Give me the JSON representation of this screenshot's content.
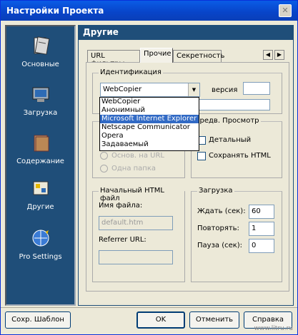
{
  "window": {
    "title": "Настройки Проекта",
    "close_label": "✕"
  },
  "sidebar": {
    "items": [
      {
        "label": "Основные",
        "icon": "notebook-icon"
      },
      {
        "label": "Загрузка",
        "icon": "monitor-download-icon"
      },
      {
        "label": "Содержание",
        "icon": "folder-icon"
      },
      {
        "label": "Другие",
        "icon": "tools-icon"
      },
      {
        "label": "Pro Settings",
        "icon": "globe-settings-icon"
      }
    ]
  },
  "content": {
    "header": "Другие",
    "tabs": [
      "URL фильтры",
      "Прочие",
      "Секретность"
    ],
    "active_tab": "Прочие"
  },
  "identification": {
    "title": "Идентификация",
    "selected": "WebCopier",
    "version_label": "версия",
    "options": [
      "WebCopier",
      "Анонимный",
      "Microsoft Internet Explorer",
      "Netscape Communicator",
      "Opera",
      "Задаваемый"
    ],
    "highlighted": "Microsoft Internet Explorer"
  },
  "save_group": {
    "radio1": "Основ. на URL",
    "radio2": "Одна папка"
  },
  "preview": {
    "title": "Предв. Просмотр",
    "detailed": "Детальный",
    "save_html": "Сохранять HTML"
  },
  "start_html": {
    "title": "Начальный HTML файл",
    "filename_label": "Имя файла:",
    "filename_value": "default.htm",
    "referrer_label": "Referrer URL:"
  },
  "download": {
    "title": "Загрузка",
    "wait_label": "Ждать (сек):",
    "wait_value": "60",
    "retry_label": "Повторять:",
    "retry_value": "1",
    "pause_label": "Пауза (сек):",
    "pause_value": "0"
  },
  "footer": {
    "save_template": "Сохр. Шаблон",
    "ok": "OK",
    "cancel": "Отменить",
    "help": "Справка"
  },
  "watermark": "www.litru.ru"
}
